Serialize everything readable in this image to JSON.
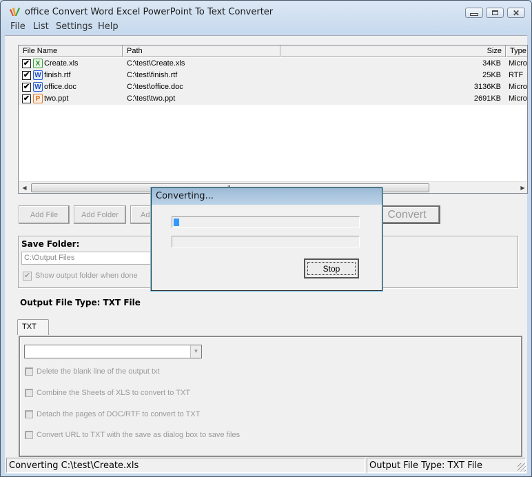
{
  "window": {
    "title": "office Convert Word Excel PowerPoint To Text Converter",
    "controls": {
      "minimize": "minimize",
      "maximize": "maximize",
      "close": "✕"
    }
  },
  "menu": [
    "File",
    "List",
    "Settings",
    "Help"
  ],
  "file_list": {
    "columns": [
      "File Name",
      "Path",
      "",
      "Size",
      "Type"
    ],
    "rows": [
      {
        "checked": true,
        "icon": "excel-file-icon",
        "icon_glyph": "X",
        "icon_class": "xls",
        "name": "Create.xls",
        "path": "C:\\test\\Create.xls",
        "size": "34KB",
        "type": "Micro"
      },
      {
        "checked": true,
        "icon": "word-file-icon",
        "icon_glyph": "W",
        "icon_class": "doc",
        "name": "finish.rtf",
        "path": "C:\\test\\finish.rtf",
        "size": "25KB",
        "type": "RTF"
      },
      {
        "checked": true,
        "icon": "word-file-icon",
        "icon_glyph": "W",
        "icon_class": "doc",
        "name": "office.doc",
        "path": "C:\\test\\office.doc",
        "size": "3136KB",
        "type": "Micro"
      },
      {
        "checked": true,
        "icon": "powerpoint-file-icon",
        "icon_glyph": "P",
        "icon_class": "ppt",
        "name": "two.ppt",
        "path": "C:\\test\\two.ppt",
        "size": "2691KB",
        "type": "Micro"
      }
    ],
    "scroll_grip": "III"
  },
  "buttons": {
    "add_file": "Add File",
    "add_folder": "Add Folder",
    "add_partial": "Add",
    "convert": "Convert"
  },
  "save_folder": {
    "label": "Save Folder:",
    "value": "C:\\Output Files",
    "show_when_done_label": "Show output folder when done",
    "show_when_done_checked": true
  },
  "output_type_label": "Output File Type:  TXT File",
  "tabs": [
    {
      "label": "TXT",
      "active": true
    }
  ],
  "txt_options": {
    "combo_value": "",
    "options": [
      {
        "label": "Delete the blank line of the output txt",
        "checked": false
      },
      {
        "label": "Combine the Sheets of XLS to convert to TXT",
        "checked": false
      },
      {
        "label": "Detach the pages of DOC/RTF to convert to TXT",
        "checked": false
      },
      {
        "label": "Convert URL to TXT with the save as dialog box to save files",
        "checked": false
      }
    ]
  },
  "status_bar": {
    "left": "Converting  C:\\test\\Create.xls",
    "right": "Output File Type:  TXT File"
  },
  "dialog": {
    "title": "Converting...",
    "progress_overall_percent": 3,
    "progress_file_percent": 0,
    "stop_label": "Stop"
  }
}
